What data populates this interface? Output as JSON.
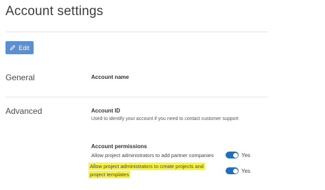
{
  "header": {
    "title": "Account settings"
  },
  "toolbar": {
    "edit_label": "Edit",
    "edit_icon": "pencil-icon",
    "accent_color": "#5b8fd2"
  },
  "sections": {
    "general": {
      "label": "General",
      "account_name_label": "Account name"
    },
    "advanced": {
      "label": "Advanced",
      "account_id_label": "Account ID",
      "account_id_help": "Used to identify your account if you need to contact customer support",
      "permissions_label": "Account permissions",
      "permissions": [
        {
          "text": "Allow project administrators to add partner companies",
          "state": "Yes",
          "enabled": true
        },
        {
          "text_line1": "Allow project administrators to create projects and",
          "text_line2": "project templates",
          "state": "Yes",
          "enabled": true,
          "highlighted": true
        }
      ]
    }
  },
  "colors": {
    "toggle_on": "#1d6fc2",
    "highlight": "#f8f53a"
  }
}
